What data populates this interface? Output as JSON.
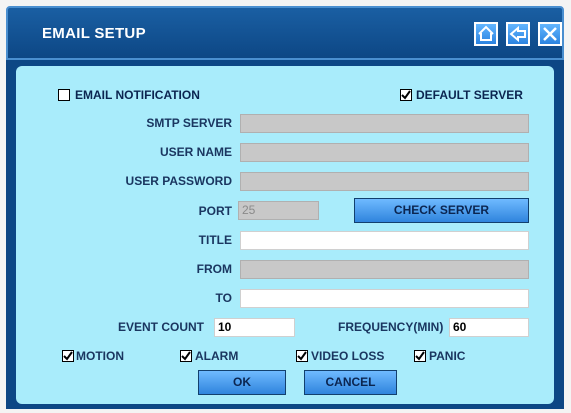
{
  "window": {
    "title": "EMAIL SETUP"
  },
  "titlebar_buttons": {
    "home": "home-icon",
    "back": "back-arrow-icon",
    "close": "close-icon"
  },
  "options": {
    "email_notification": {
      "label": "EMAIL NOTIFICATION",
      "checked": false
    },
    "default_server": {
      "label": "DEFAULT SERVER",
      "checked": true
    }
  },
  "fields": {
    "smtp_server": {
      "label": "SMTP SERVER",
      "value": ""
    },
    "user_name": {
      "label": "USER NAME",
      "value": ""
    },
    "user_password": {
      "label": "USER PASSWORD",
      "value": ""
    },
    "port": {
      "label": "PORT",
      "value": "25"
    },
    "title": {
      "label": "TITLE",
      "value": ""
    },
    "from": {
      "label": "FROM",
      "value": ""
    },
    "to": {
      "label": "TO",
      "value": ""
    },
    "event_count": {
      "label": "EVENT COUNT",
      "value": "10"
    },
    "frequency": {
      "label": "FREQUENCY(MIN)",
      "value": "60"
    }
  },
  "buttons": {
    "check_server": "CHECK SERVER",
    "ok": "OK",
    "cancel": "CANCEL"
  },
  "events": [
    {
      "label": "MOTION",
      "checked": true
    },
    {
      "label": "ALARM",
      "checked": true
    },
    {
      "label": "VIDEO LOSS",
      "checked": true
    },
    {
      "label": "PANIC",
      "checked": true
    }
  ],
  "colors": {
    "title_bar": "#0d4785",
    "panel": "#a9ecfb",
    "button": "#4a9cf0",
    "label": "#1a3660"
  }
}
